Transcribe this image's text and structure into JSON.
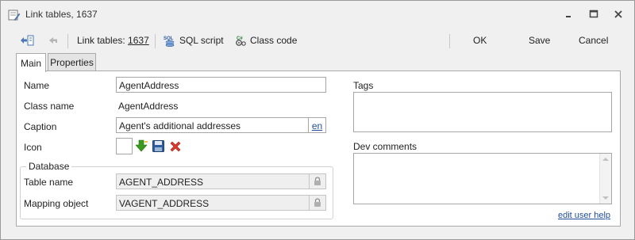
{
  "window": {
    "title": "Link tables, 1637"
  },
  "toolbar": {
    "breadcrumb_prefix": "Link tables: ",
    "breadcrumb_id": "1637",
    "sql_script_label": "SQL script",
    "class_code_label": "Class code",
    "ok_label": "OK",
    "save_label": "Save",
    "cancel_label": "Cancel"
  },
  "tabs": [
    {
      "label": "Main",
      "active": true
    },
    {
      "label": "Properties",
      "active": false
    }
  ],
  "form": {
    "name_label": "Name",
    "name_value": "AgentAddress",
    "class_name_label": "Class name",
    "class_name_value": "AgentAddress",
    "caption_label": "Caption",
    "caption_value": "Agent's additional addresses",
    "caption_lang": "en",
    "icon_label": "Icon",
    "database_group_title": "Database",
    "table_name_label": "Table name",
    "table_name_value": "AGENT_ADDRESS",
    "mapping_object_label": "Mapping object",
    "mapping_object_value": "VAGENT_ADDRESS",
    "tags_label": "Tags",
    "dev_comments_label": "Dev comments",
    "edit_help_link": "edit user help"
  },
  "icons": {
    "back": "back-arrow-icon",
    "up": "up-arrow-icon",
    "sql": "sql-icon",
    "code": "code-icon",
    "download": "download-icon",
    "save": "floppy-icon",
    "delete": "delete-icon",
    "lock": "lock-icon"
  },
  "colors": {
    "link": "#1f4e9c",
    "download_green": "#3a9a1e",
    "delete_red": "#d93a2b"
  }
}
